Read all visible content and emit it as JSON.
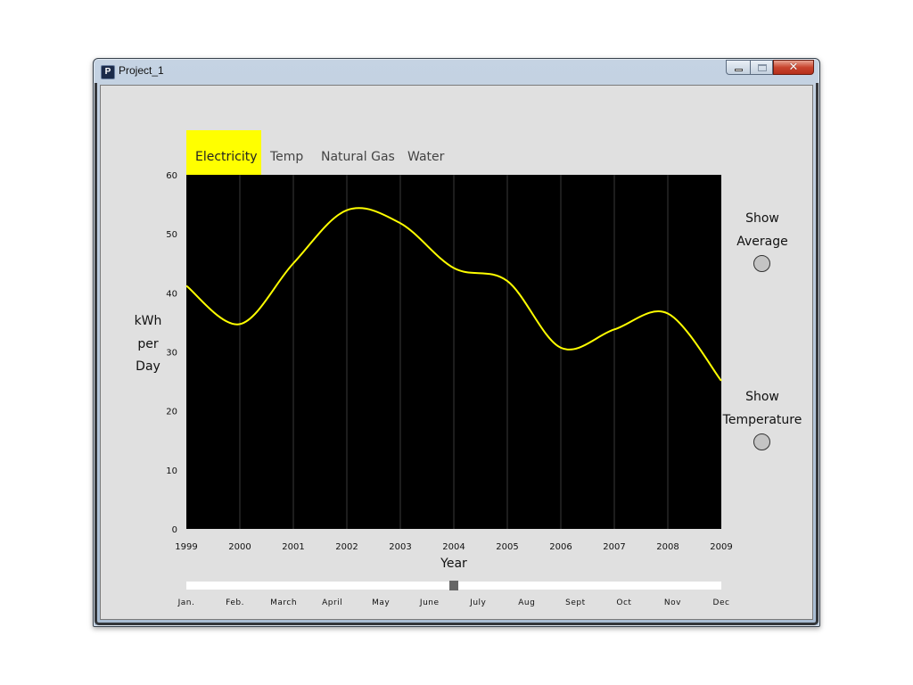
{
  "window": {
    "title": "Project_1",
    "icon": "processing-app-icon"
  },
  "tabs": [
    {
      "label": "Electricity",
      "active": true
    },
    {
      "label": "Temp",
      "active": false
    },
    {
      "label": "Natural Gas",
      "active": false
    },
    {
      "label": "Water",
      "active": false
    }
  ],
  "y_axis_label": [
    "kWh",
    "per",
    "Day"
  ],
  "toggles": [
    {
      "line1": "Show",
      "line2": "Average"
    },
    {
      "line1": "Show",
      "line2": "Temperature"
    }
  ],
  "month_slider": {
    "months": [
      "Jan.",
      "Feb.",
      "March",
      "April",
      "May",
      "June",
      "July",
      "Aug",
      "Sept",
      "Oct",
      "Nov",
      "Dec"
    ],
    "value_fraction": 0.5
  },
  "colors": {
    "accent": "#ffff00",
    "plot_bg": "#000000",
    "line": "#ffff00",
    "panel": "#e0e0e0"
  },
  "chart_data": {
    "type": "line",
    "xlabel": "Year",
    "ylabel": "kWh per Day",
    "x": [
      1999,
      2000,
      2001,
      2002,
      2003,
      2004,
      2005,
      2006,
      2007,
      2008,
      2009
    ],
    "xlim": [
      1999,
      2009
    ],
    "ylim": [
      0,
      60
    ],
    "yticks": [
      0,
      10,
      20,
      30,
      40,
      50,
      60
    ],
    "grid": "vertical",
    "series": [
      {
        "values": [
          41.2,
          34.7,
          45.0,
          54.0,
          51.8,
          44.2,
          42.0,
          30.7,
          33.8,
          36.5,
          25.1
        ]
      }
    ]
  }
}
